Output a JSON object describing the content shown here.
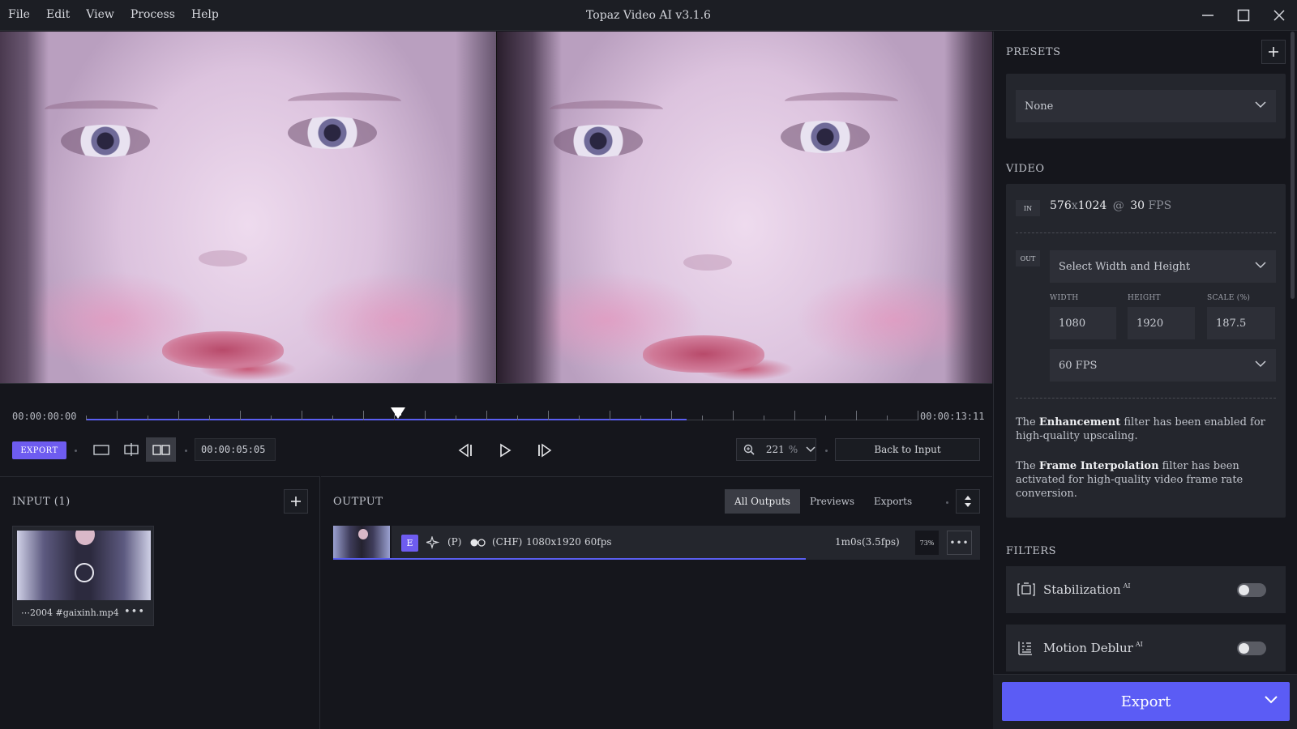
{
  "menu": [
    "File",
    "Edit",
    "View",
    "Process",
    "Help"
  ],
  "app_title": "Topaz Video AI   v3.1.6",
  "timeline": {
    "start": "00:00:00:00",
    "end": "00:00:13:11",
    "playhead_fraction": 0.375,
    "processed_fraction": 0.722,
    "current_time": "00:00:05:05",
    "zoom_value": "221",
    "zoom_unit": "%",
    "back_to_input": "Back to Input",
    "export_small": "EXPORT"
  },
  "input": {
    "label": "INPUT (1)",
    "file_name": "⋯2004 #gaixinh.mp4"
  },
  "output": {
    "label": "OUTPUT",
    "tabs": [
      "All Outputs",
      "Previews",
      "Exports"
    ],
    "active_tab": "All Outputs",
    "row": {
      "badge": "E",
      "p": "(P)",
      "chf": "(CHF)",
      "resolution": "1080x1920",
      "fps": "60fps",
      "time": "1m0s",
      "rate": "(3.5fps)",
      "percent": "73%",
      "progress": 0.73
    }
  },
  "sidebar": {
    "presets_label": "PRESETS",
    "preset_value": "None",
    "video_label": "VIDEO",
    "in_tag": "IN",
    "in_w": "576",
    "in_x": "x",
    "in_h": "1024",
    "in_at": "@",
    "in_fps": "30",
    "in_fps_unit": "FPS",
    "out_tag": "OUT",
    "size_select": "Select Width and Height",
    "width_label": "WIDTH",
    "height_label": "HEIGHT",
    "scale_label": "SCALE (%)",
    "width": "1080",
    "height": "1920",
    "scale": "187.5",
    "fps_select": "60 FPS",
    "note1_pre": "The ",
    "note1_bold": "Enhancement",
    "note1_post": " filter has been enabled for high-quality upscaling.",
    "note2_pre": "The ",
    "note2_bold": "Frame Interpolation",
    "note2_post": " filter has been activated for high-quality video frame rate conversion.",
    "filters_label": "FILTERS",
    "filters": [
      {
        "name": "Stabilization",
        "ai": "AI",
        "enabled": false
      },
      {
        "name": "Motion Deblur",
        "ai": "AI",
        "enabled": false
      }
    ],
    "export_label": "Export"
  }
}
